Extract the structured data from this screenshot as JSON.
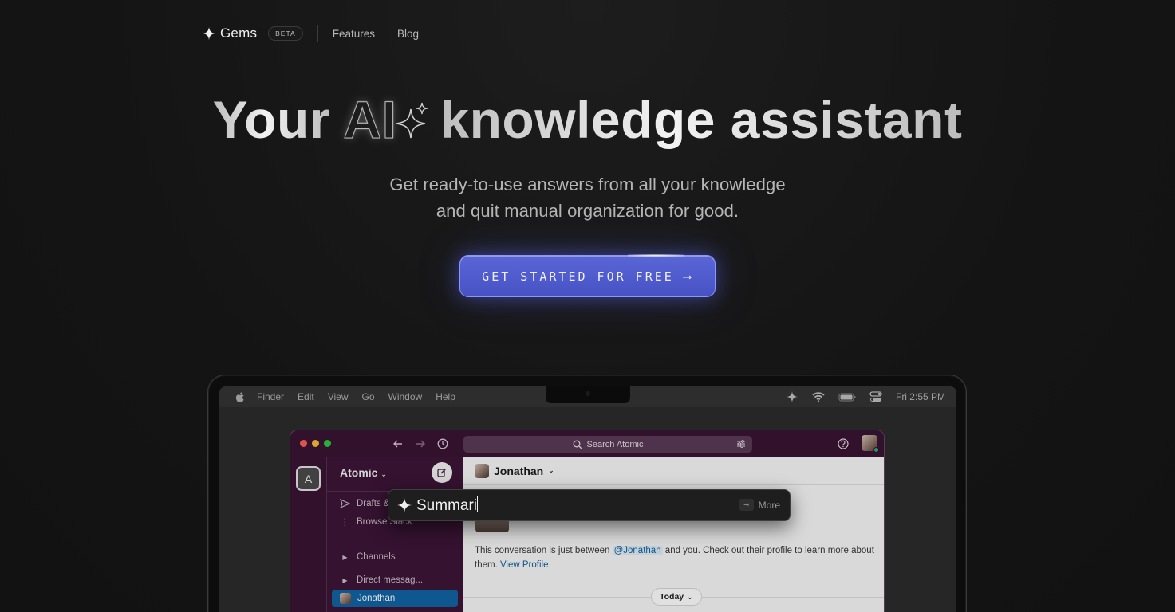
{
  "nav": {
    "brand": "Gems",
    "badge": "BETA",
    "links": [
      "Features",
      "Blog"
    ]
  },
  "hero": {
    "title_pre": "Your",
    "title_ai": "AI",
    "title_post": "knowledge assistant",
    "subtitle_line1": "Get ready-to-use answers from all your knowledge",
    "subtitle_line2": "and quit manual organization for good.",
    "cta": "GET STARTED FOR FREE",
    "cta_arrow": "⟶"
  },
  "menubar": {
    "items": [
      "Finder",
      "Edit",
      "View",
      "Go",
      "Window",
      "Help"
    ],
    "clock": "Fri 2:55 PM"
  },
  "slack": {
    "search_placeholder": "Search Atomic",
    "workspace_initial": "A",
    "workspace_name": "Atomic",
    "sidebar": {
      "drafts": "Drafts &",
      "browse": "Browse Slack",
      "channels": "Channels",
      "direct": "Direct messag...",
      "active_dm": "Jonathan"
    },
    "channel_title": "Jonathan",
    "convo_pre": "This conversation is just between",
    "convo_mention": "@Jonathan",
    "convo_post": "and you. Check out their profile to learn more about them.",
    "view_profile": "View Profile",
    "today": "Today"
  },
  "gems_popup": {
    "input": "Summari",
    "more": "More",
    "tab_key": "⇥"
  },
  "colors": {
    "cta": "#4f5bd0",
    "slack_aubergine": "#3c1537",
    "active_item": "#1164a3"
  }
}
